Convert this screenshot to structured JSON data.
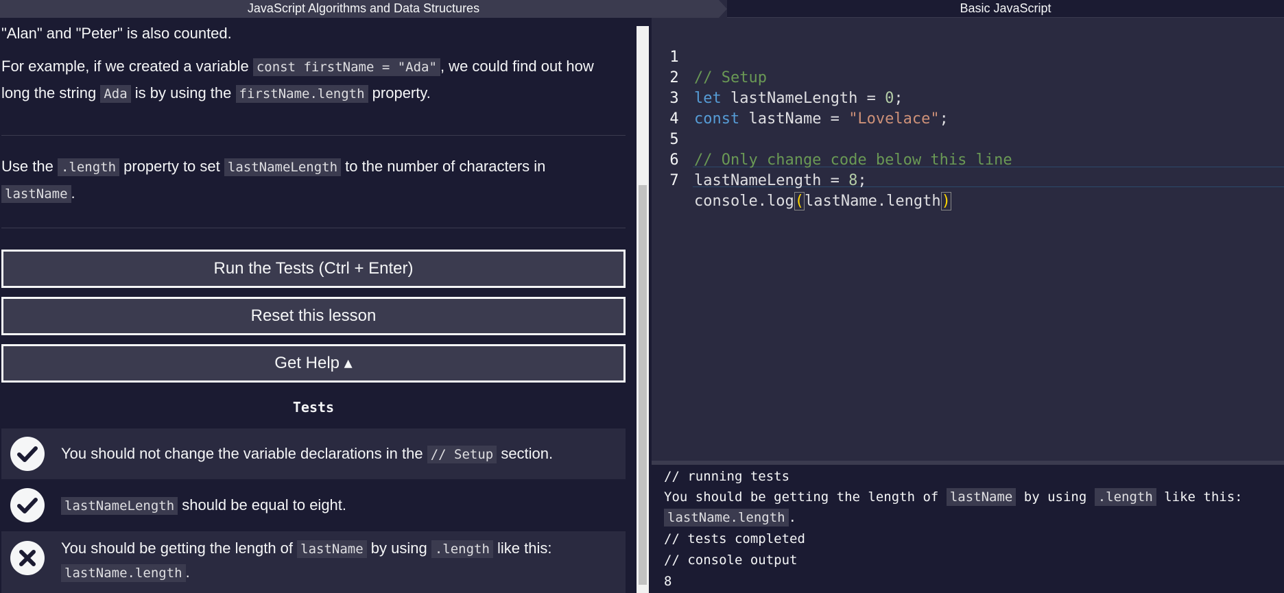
{
  "breadcrumb": {
    "course": "JavaScript Algorithms and Data Structures",
    "section": "Basic JavaScript"
  },
  "description": {
    "p0": "\"Alan\" and \"Peter\" is also counted.",
    "p1_a": "For example, if we created a variable ",
    "p1_code1": "const firstName = \"Ada\"",
    "p1_b": ", we could find out how",
    "p1_c": "long the string ",
    "p1_code2": "Ada",
    "p1_d": " is by using the ",
    "p1_code3": "firstName.length",
    "p1_e": " property."
  },
  "instructions": {
    "a": "Use the ",
    "code1": ".length",
    "b": " property to set ",
    "code2": "lastNameLength",
    "c": " to the number of characters in",
    "code3": "lastName",
    "d": "."
  },
  "buttons": {
    "run": "Run the Tests (Ctrl + Enter)",
    "reset": "Reset this lesson",
    "help": "Get Help ▴"
  },
  "tests": {
    "title": "Tests",
    "items": [
      {
        "status": "pass",
        "a": "You should not change the variable declarations in the ",
        "code": "// Setup",
        "b": " section."
      },
      {
        "status": "pass",
        "code": "lastNameLength",
        "b": " should be equal to eight."
      },
      {
        "status": "fail",
        "a": "You should be getting the length of ",
        "code": "lastName",
        "b": " by using ",
        "code2": ".length",
        "c": " like this:",
        "code3": "lastName.length",
        "d": "."
      }
    ]
  },
  "editor": {
    "lines": [
      {
        "n": "1",
        "text": "// Setup"
      },
      {
        "n": "2",
        "kw": "let",
        "rest": " lastNameLength = ",
        "num": "0",
        "end": ";"
      },
      {
        "n": "3",
        "kw": "const",
        "rest": " lastName = ",
        "str": "\"Lovelace\"",
        "end": ";"
      },
      {
        "n": "4"
      },
      {
        "n": "5",
        "text": "// Only change code below this line"
      },
      {
        "n": "6",
        "rest": "lastNameLength = ",
        "num": "8",
        "end": ";"
      },
      {
        "n": "7",
        "a": "console.log",
        "b": "(",
        "c": "lastName.length",
        "d": ")"
      }
    ]
  },
  "console": {
    "l1": "// running tests",
    "l2_a": "You should be getting the length of ",
    "l2_code1": "lastName",
    "l2_b": " by using ",
    "l2_code2": ".length",
    "l2_c": " like this:",
    "l3_code": "lastName.length",
    "l3_b": ".",
    "l4": "// tests completed",
    "l5": "// console output",
    "l6": "8"
  },
  "colors": {
    "bg": "#1b1b32",
    "panel": "#2a2a40",
    "button": "#3b3b4f",
    "comment": "#6a9955",
    "keyword": "#569cd6",
    "string": "#ce9178",
    "number": "#b5cea8"
  },
  "icons": [
    "check-circle-icon",
    "check-circle-icon",
    "x-circle-icon",
    "caret-up-icon"
  ]
}
